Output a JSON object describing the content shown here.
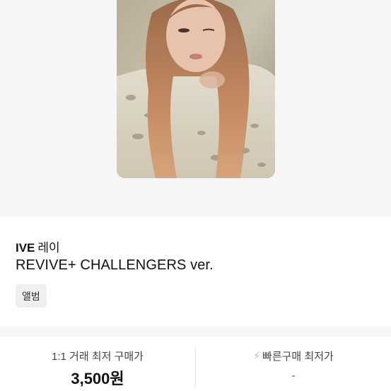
{
  "product": {
    "group": "IVE",
    "member": "레이",
    "version": "REVIVE+ CHALLENGERS ver.",
    "tag": "앨범"
  },
  "prices": {
    "direct_label": "1:1 거래 최저 구매가",
    "direct_value": "3,500원",
    "quick_label": "빠른구매 최저가",
    "quick_value": "-"
  },
  "icons": {
    "quick": "lightning-icon"
  },
  "colors": {
    "background": "#ffffff",
    "panel": "#f6f6f7",
    "tag_bg": "#eeeff1",
    "bolt": "#aab2e6"
  }
}
